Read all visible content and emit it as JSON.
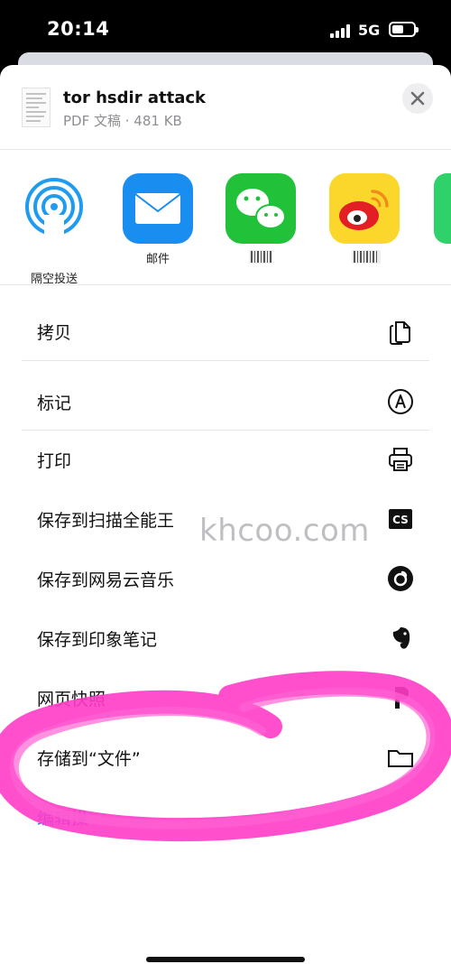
{
  "status_bar": {
    "time": "20:14",
    "network": "5G"
  },
  "header": {
    "doc_title": "tor hsdir attack",
    "doc_meta": "PDF 文稿 · 481 KB",
    "close_icon": "close-icon"
  },
  "apps": [
    {
      "label": "隔空投送",
      "icon": "airdrop-icon"
    },
    {
      "label": "邮件",
      "icon": "mail-icon"
    },
    {
      "label": "",
      "icon": "wechat-icon"
    },
    {
      "label": "",
      "icon": "weibo-icon"
    }
  ],
  "actions": [
    {
      "label": "拷贝",
      "icon": "copy-icon"
    },
    {
      "label": "标记",
      "icon": "markup-icon"
    },
    {
      "label": "打印",
      "icon": "printer-icon"
    },
    {
      "label": "保存到扫描全能王",
      "icon": "camscanner-icon"
    },
    {
      "label": "保存到网易云音乐",
      "icon": "netease-music-icon"
    },
    {
      "label": "保存到印象笔记",
      "icon": "evernote-icon"
    },
    {
      "label": "网页快照",
      "icon": "pocket-icon"
    },
    {
      "label": "存储到“文件”",
      "icon": "folder-icon"
    },
    {
      "label": "编辑操",
      "icon": ""
    }
  ],
  "watermark": "khcoo.com",
  "colors": {
    "accent": "#1a7cf5",
    "annotation": "#ff3cc8"
  }
}
